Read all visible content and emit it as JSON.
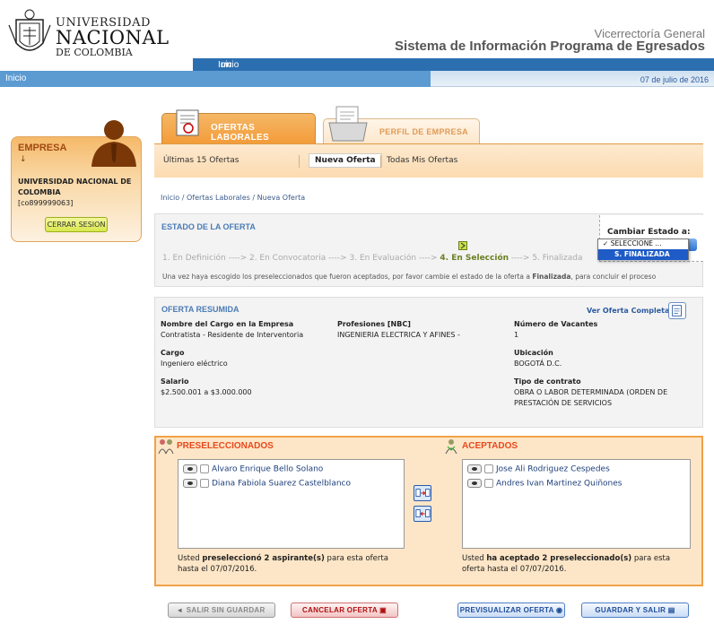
{
  "header": {
    "logo_line1": "UNIVERSIDAD",
    "logo_line2": "NACIONAL",
    "logo_line3": "DE COLOMBIA",
    "subtitle": "Vicerrectoría General",
    "title": "Sistema de Información Programa de Egresados"
  },
  "nav": {
    "tab_label": "Inicio",
    "tab_brand": "un",
    "breadcrumb_home": "Inicio",
    "date": "07 de julio de 2016"
  },
  "empresa": {
    "heading": "EMPRESA",
    "arrow": "↓",
    "name": "UNIVERSIDAD NACIONAL DE COLOMBIA",
    "code": "[co899999063]",
    "logout_label": "CERRAR SESION"
  },
  "tabs": [
    {
      "label": "OFERTAS LABORALES",
      "active": true
    },
    {
      "label": "PERFIL DE EMPRESA",
      "active": false
    }
  ],
  "subnav": {
    "item1": "Últimas 15 Ofertas",
    "item2": "Nueva Oferta",
    "item3": "Todas Mis Ofertas"
  },
  "breadcrumb": "Inicio / Ofertas Laborales / Nueva Oferta",
  "estado": {
    "title": "ESTADO DE LA OFERTA",
    "steps": [
      "1. En Definición",
      "2. En Convocatoria",
      "3. En Evaluación",
      "4. En Selección",
      "5. Finalizada"
    ],
    "arrow": "---->",
    "current_step": "4. En Selección",
    "note_pre": "Una vez haya escogido los preseleccionados que fueron aceptados, por favor cambie el estado de la oferta a ",
    "note_bold": "Finalizada",
    "note_post": ", para concluir el proceso",
    "change_label": "Cambiar Estado a:",
    "dropdown_options": [
      "SELECCIONE ...",
      "S. FINALIZADA"
    ],
    "checkmark": "✓"
  },
  "resumen": {
    "title": "OFERTA RESUMIDA",
    "view_link": "Ver Oferta Completa",
    "cargo_empresa_label": "Nombre del Cargo en la Empresa",
    "cargo_empresa": "Contratista - Residente de Interventoria",
    "profesiones_label": "Profesiones [NBC]",
    "profesiones": "INGENIERIA ELECTRICA Y AFINES -",
    "vacantes_label": "Número de Vacantes",
    "vacantes": "1",
    "cargo_label": "Cargo",
    "cargo": "Ingeniero eléctrico",
    "ubicacion_label": "Ubicación",
    "ubicacion": "BOGOTÁ D.C.",
    "salario_label": "Salario",
    "salario": "$2.500.001 a $3.000.000",
    "contrato_label": "Tipo de contrato",
    "contrato_line1": "OBRA O LABOR DETERMINADA (ORDEN DE",
    "contrato_line2": "PRESTACIÓN DE SERVICIOS"
  },
  "seleccion": {
    "pre_title": "PRESELECCIONADOS",
    "ace_title": "ACEPTADOS",
    "preseleccionados": [
      "Alvaro Enrique Bello Solano",
      "Diana Fabiola Suarez Castelblanco"
    ],
    "aceptados": [
      "Jose Ali Rodriguez Cespedes",
      "Andres Ivan Martinez Quiñones"
    ],
    "pre_msg_a": "Usted ",
    "pre_msg_b": "preseleccionó 2 aspirante(s)",
    "pre_msg_c": " para esta oferta",
    "pre_msg_d": "hasta el 07/07/2016.",
    "ace_msg_a": "Usted ",
    "ace_msg_b": "ha aceptado 2 preseleccionado(s)",
    "ace_msg_c": " para esta",
    "ace_msg_d": "oferta hasta el 07/07/2016."
  },
  "buttons": {
    "exit": "SALIR SIN GUARDAR",
    "cancel": "CANCELAR OFERTA",
    "preview": "PREVISUALIZAR OFERTA",
    "save": "GUARDAR Y SALIR"
  },
  "colors": {
    "brand_blue": "#2c6fb0",
    "orange": "#f39c3a",
    "link_blue": "#4a7bb5",
    "alert_red": "#e8491d"
  }
}
